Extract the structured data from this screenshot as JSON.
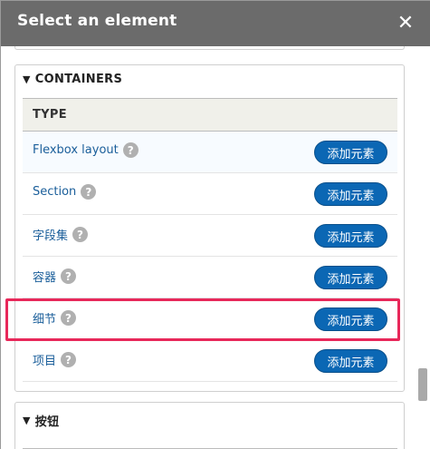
{
  "dialog": {
    "title": "Select an element",
    "close_glyph": "✕"
  },
  "containers": {
    "legend": "CONTAINERS",
    "header": "TYPE",
    "rows": [
      {
        "label": "Flexbox layout",
        "help": "?",
        "button": "添加元素"
      },
      {
        "label": "Section",
        "help": "?",
        "button": "添加元素"
      },
      {
        "label": "字段集",
        "help": "?",
        "button": "添加元素"
      },
      {
        "label": "容器",
        "help": "?",
        "button": "添加元素"
      },
      {
        "label": "细节",
        "help": "?",
        "button": "添加元素"
      },
      {
        "label": "项目",
        "help": "?",
        "button": "添加元素"
      }
    ]
  },
  "buttons_section": {
    "legend": "按钮"
  },
  "icons": {
    "collapse": "triangle-down-icon",
    "help": "question-mark-icon",
    "close": "close-icon"
  },
  "colors": {
    "titlebar": "#6b6b6b",
    "link": "#1a5e9a",
    "button": "#0b67b4",
    "highlight": "#e8285a",
    "help_badge": "#b0b0b0"
  }
}
